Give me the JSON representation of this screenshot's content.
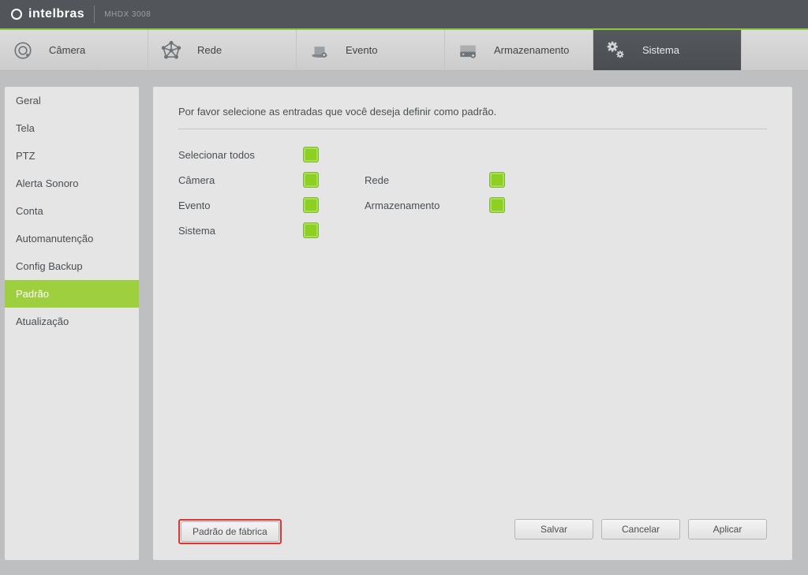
{
  "header": {
    "brand": "intelbras",
    "model": "MHDX 3008"
  },
  "top_nav": {
    "camera": {
      "label": "Câmera"
    },
    "network": {
      "label": "Rede"
    },
    "event": {
      "label": "Evento"
    },
    "storage": {
      "label": "Armazenamento"
    },
    "system": {
      "label": "Sistema",
      "active": true
    }
  },
  "sidebar": {
    "items": [
      {
        "label": "Geral"
      },
      {
        "label": "Tela"
      },
      {
        "label": "PTZ"
      },
      {
        "label": "Alerta Sonoro"
      },
      {
        "label": "Conta"
      },
      {
        "label": "Automanutenção"
      },
      {
        "label": "Config Backup"
      },
      {
        "label": "Padrão",
        "active": true
      },
      {
        "label": "Atualização"
      }
    ]
  },
  "panel": {
    "description": "Por favor selecione as entradas que você deseja definir como padrão.",
    "options": {
      "select_all": "Selecionar todos",
      "camera": "Câmera",
      "network": "Rede",
      "event": "Evento",
      "storage": "Armazenamento",
      "system": "Sistema"
    },
    "buttons": {
      "factory_default": "Padrão de fábrica",
      "save": "Salvar",
      "cancel": "Cancelar",
      "apply": "Aplicar"
    }
  }
}
